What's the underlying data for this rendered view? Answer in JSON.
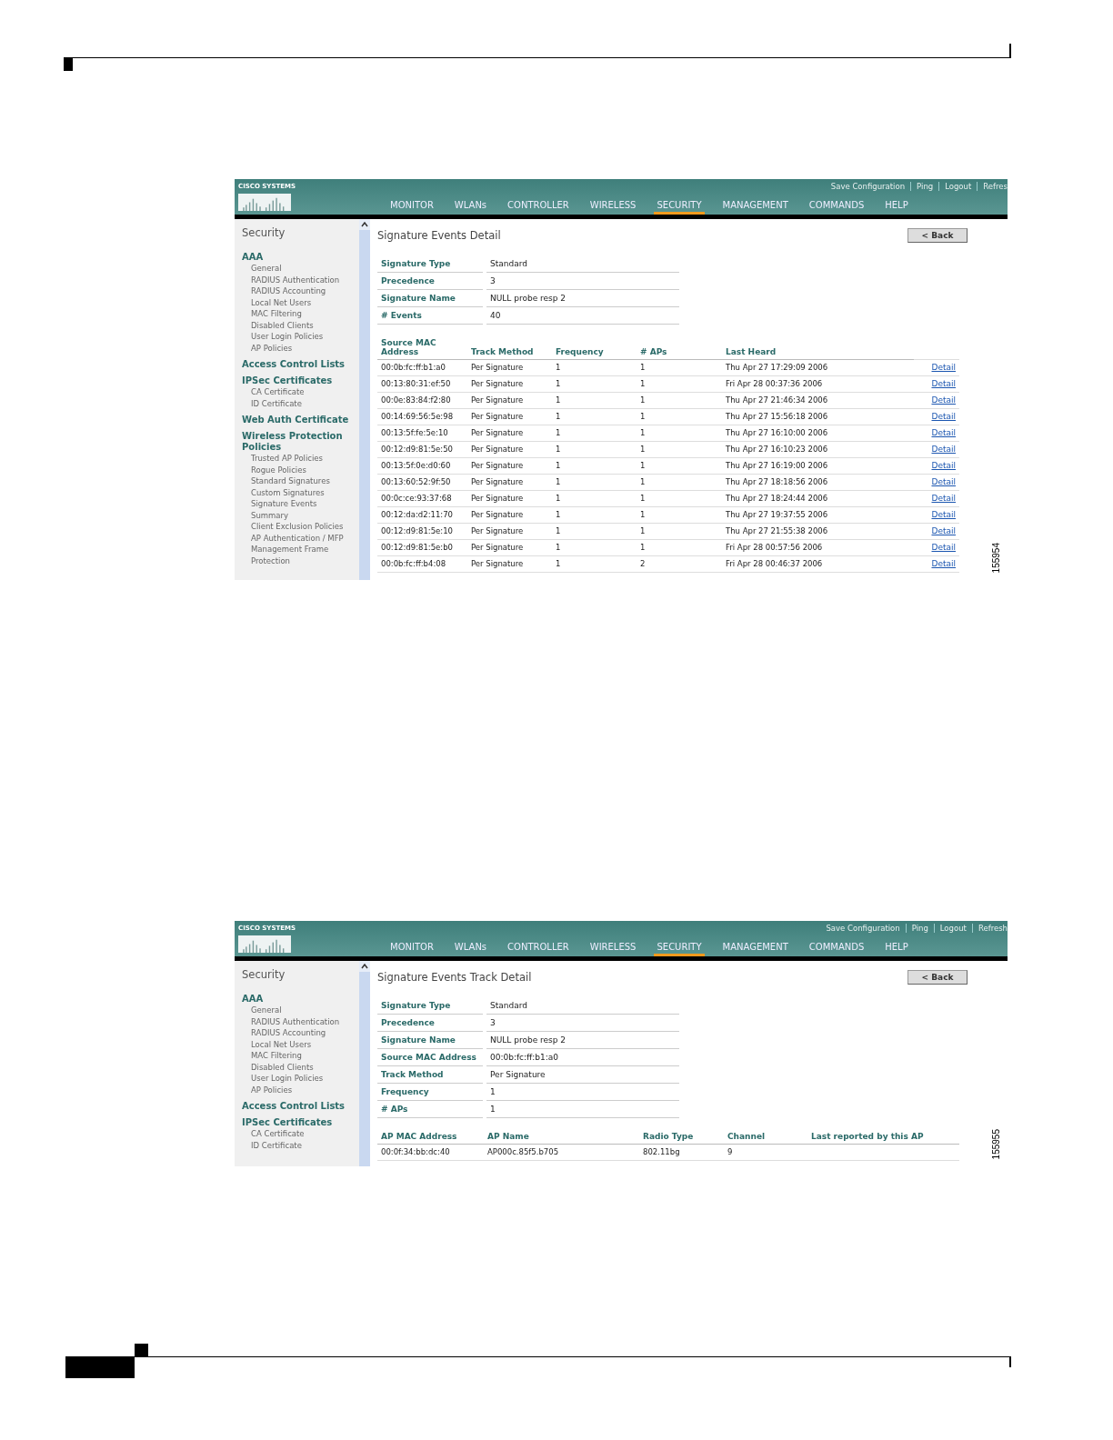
{
  "screens": [
    {
      "logo": "CISCO SYSTEMS",
      "header_links": [
        "Save Configuration",
        "Ping",
        "Logout",
        "Refres"
      ],
      "nav": [
        {
          "label": "MONITOR",
          "selected": false
        },
        {
          "label": "WLANs",
          "selected": false
        },
        {
          "label": "CONTROLLER",
          "selected": false
        },
        {
          "label": "WIRELESS",
          "selected": false
        },
        {
          "label": "SECURITY",
          "selected": true
        },
        {
          "label": "MANAGEMENT",
          "selected": false
        },
        {
          "label": "COMMANDS",
          "selected": false
        },
        {
          "label": "HELP",
          "selected": false
        }
      ],
      "sidebar": {
        "title": "Security",
        "items": [
          {
            "label": "AAA",
            "children": [
              {
                "label": "General"
              },
              {
                "label": "RADIUS Authentication"
              },
              {
                "label": "RADIUS Accounting"
              },
              {
                "label": "Local Net Users"
              },
              {
                "label": "MAC Filtering"
              },
              {
                "label": "Disabled Clients"
              },
              {
                "label": "User Login Policies"
              },
              {
                "label": "AP Policies"
              }
            ]
          },
          {
            "label": "Access Control Lists"
          },
          {
            "label": "IPSec Certificates",
            "children": [
              {
                "label": "CA Certificate"
              },
              {
                "label": "ID Certificate"
              }
            ]
          },
          {
            "label": "Web Auth Certificate"
          },
          {
            "label": "Wireless Protection Policies",
            "children": [
              {
                "label": "Trusted AP Policies"
              },
              {
                "label": "Rogue Policies"
              },
              {
                "label": "Standard Signatures"
              },
              {
                "label": "Custom Signatures"
              },
              {
                "label": "Signature Events Summary"
              },
              {
                "label": "Client Exclusion Policies"
              },
              {
                "label": "AP Authentication / MFP"
              },
              {
                "label": "Management Frame Protection"
              }
            ]
          }
        ]
      },
      "title": "Signature Events Detail",
      "back_button": "< Back",
      "details": [
        {
          "label": "Signature Type",
          "value": "Standard"
        },
        {
          "label": "Precedence",
          "value": "3"
        },
        {
          "label": "Signature Name",
          "value": "NULL probe resp 2"
        },
        {
          "label": "# Events",
          "value": "40"
        }
      ],
      "table": {
        "columns": [
          "Source MAC Address",
          "Track Method",
          "Frequency",
          "# APs",
          "Last Heard"
        ],
        "rows": [
          {
            "cells": [
              "00:0b:fc:ff:b1:a0",
              "Per Signature",
              "1",
              "1",
              "Thu Apr 27 17:29:09 2006"
            ],
            "link": "Detail"
          },
          {
            "cells": [
              "00:13:80:31:ef:50",
              "Per Signature",
              "1",
              "1",
              "Fri Apr 28 00:37:36 2006"
            ],
            "link": "Detail"
          },
          {
            "cells": [
              "00:0e:83:84:f2:80",
              "Per Signature",
              "1",
              "1",
              "Thu Apr 27 21:46:34 2006"
            ],
            "link": "Detail"
          },
          {
            "cells": [
              "00:14:69:56:5e:98",
              "Per Signature",
              "1",
              "1",
              "Thu Apr 27 15:56:18 2006"
            ],
            "link": "Detail"
          },
          {
            "cells": [
              "00:13:5f:fe:5e:10",
              "Per Signature",
              "1",
              "1",
              "Thu Apr 27 16:10:00 2006"
            ],
            "link": "Detail"
          },
          {
            "cells": [
              "00:12:d9:81:5e:50",
              "Per Signature",
              "1",
              "1",
              "Thu Apr 27 16:10:23 2006"
            ],
            "link": "Detail"
          },
          {
            "cells": [
              "00:13:5f:0e:d0:60",
              "Per Signature",
              "1",
              "1",
              "Thu Apr 27 16:19:00 2006"
            ],
            "link": "Detail"
          },
          {
            "cells": [
              "00:13:60:52:9f:50",
              "Per Signature",
              "1",
              "1",
              "Thu Apr 27 18:18:56 2006"
            ],
            "link": "Detail"
          },
          {
            "cells": [
              "00:0c:ce:93:37:68",
              "Per Signature",
              "1",
              "1",
              "Thu Apr 27 18:24:44 2006"
            ],
            "link": "Detail"
          },
          {
            "cells": [
              "00:12:da:d2:11:70",
              "Per Signature",
              "1",
              "1",
              "Thu Apr 27 19:37:55 2006"
            ],
            "link": "Detail"
          },
          {
            "cells": [
              "00:12:d9:81:5e:10",
              "Per Signature",
              "1",
              "1",
              "Thu Apr 27 21:55:38 2006"
            ],
            "link": "Detail"
          },
          {
            "cells": [
              "00:12:d9:81:5e:b0",
              "Per Signature",
              "1",
              "1",
              "Fri Apr 28 00:57:56 2006"
            ],
            "link": "Detail"
          },
          {
            "cells": [
              "00:0b:fc:ff:b4:08",
              "Per Signature",
              "1",
              "2",
              "Fri Apr 28 00:46:37 2006"
            ],
            "link": "Detail"
          }
        ]
      },
      "figure_number": "155954"
    },
    {
      "logo": "CISCO SYSTEMS",
      "header_links": [
        "Save Configuration",
        "Ping",
        "Logout",
        "Refresh"
      ],
      "nav": [
        {
          "label": "MONITOR",
          "selected": false
        },
        {
          "label": "WLANs",
          "selected": false
        },
        {
          "label": "CONTROLLER",
          "selected": false
        },
        {
          "label": "WIRELESS",
          "selected": false
        },
        {
          "label": "SECURITY",
          "selected": true
        },
        {
          "label": "MANAGEMENT",
          "selected": false
        },
        {
          "label": "COMMANDS",
          "selected": false
        },
        {
          "label": "HELP",
          "selected": false
        }
      ],
      "sidebar": {
        "title": "Security",
        "items": [
          {
            "label": "AAA",
            "children": [
              {
                "label": "General"
              },
              {
                "label": "RADIUS Authentication"
              },
              {
                "label": "RADIUS Accounting"
              },
              {
                "label": "Local Net Users"
              },
              {
                "label": "MAC Filtering"
              },
              {
                "label": "Disabled Clients"
              },
              {
                "label": "User Login Policies"
              },
              {
                "label": "AP Policies"
              }
            ]
          },
          {
            "label": "Access Control Lists"
          },
          {
            "label": "IPSec Certificates",
            "children": [
              {
                "label": "CA Certificate"
              },
              {
                "label": "ID Certificate"
              }
            ]
          }
        ]
      },
      "title": "Signature Events Track Detail",
      "back_button": "< Back",
      "details": [
        {
          "label": "Signature Type",
          "value": "Standard"
        },
        {
          "label": "Precedence",
          "value": "3"
        },
        {
          "label": "Signature Name",
          "value": "NULL probe resp 2"
        },
        {
          "label": "Source MAC Address",
          "value": "00:0b:fc:ff:b1:a0"
        },
        {
          "label": "Track Method",
          "value": "Per Signature"
        },
        {
          "label": "Frequency",
          "value": "1"
        },
        {
          "label": "# APs",
          "value": "1"
        }
      ],
      "table": {
        "columns": [
          "AP MAC Address",
          "AP Name",
          "Radio Type",
          "Channel",
          "Last reported by this AP"
        ],
        "rows": [
          {
            "cells": [
              "00:0f:34:bb:dc:40",
              "AP000c.85f5.b705",
              "802.11bg",
              "9"
            ]
          }
        ]
      },
      "figure_number": "155955"
    }
  ]
}
